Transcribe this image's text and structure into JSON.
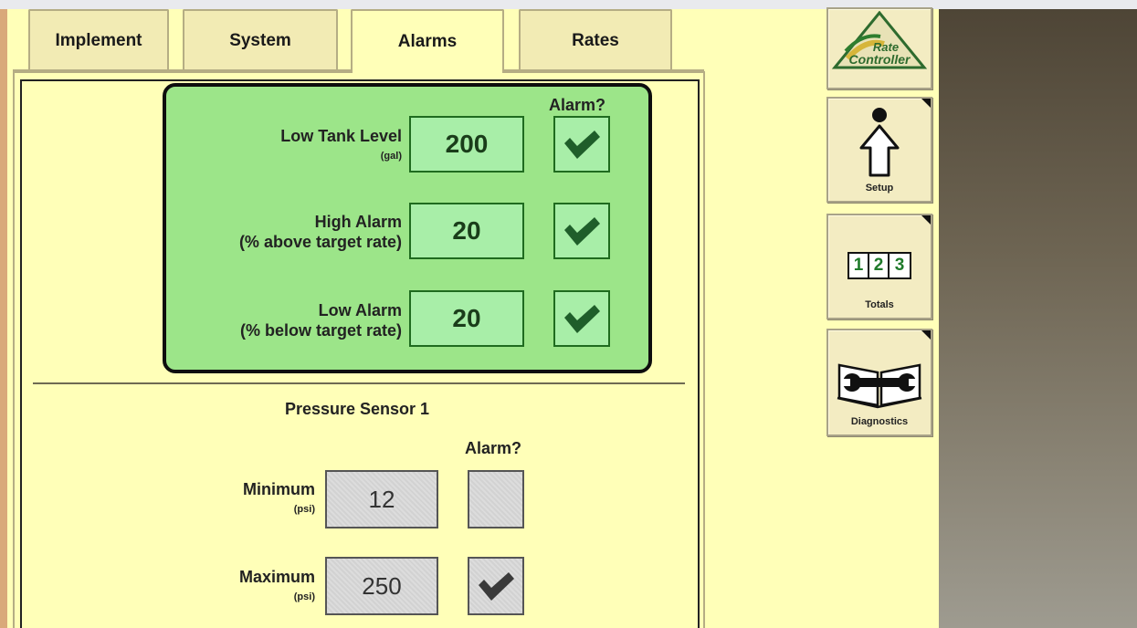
{
  "tabs": [
    {
      "label": "Implement"
    },
    {
      "label": "System"
    },
    {
      "label": "Alarms",
      "active": true
    },
    {
      "label": "Rates"
    }
  ],
  "alarm_section": {
    "alarm_header": "Alarm?",
    "rows": [
      {
        "label": "Low Tank Level",
        "unit": "(gal)",
        "value": "200",
        "alarm": true
      },
      {
        "label": "High Alarm",
        "unit": "(% above target rate)",
        "value": "20",
        "alarm": true
      },
      {
        "label": "Low Alarm",
        "unit": "(% below target rate)",
        "value": "20",
        "alarm": true
      }
    ]
  },
  "pressure_section": {
    "title": "Pressure Sensor 1",
    "alarm_header": "Alarm?",
    "rows": [
      {
        "label": "Minimum",
        "unit": "(psi)",
        "value": "12",
        "alarm": false
      },
      {
        "label": "Maximum",
        "unit": "(psi)",
        "value": "250",
        "alarm": true
      }
    ]
  },
  "side_buttons": {
    "rate_controller": {
      "line1": "Rate",
      "line2": "Controller"
    },
    "setup": {
      "label": "Setup"
    },
    "totals": {
      "label": "Totals",
      "digits": [
        "1",
        "2",
        "3"
      ]
    },
    "diagnostics": {
      "label": "Diagnostics"
    }
  },
  "colors": {
    "background": "#ffffb8",
    "green_panel": "#9ce589",
    "field_green": "#a8eea8",
    "check_green": "#1f5e2a",
    "check_gray": "#3a3a3a"
  }
}
